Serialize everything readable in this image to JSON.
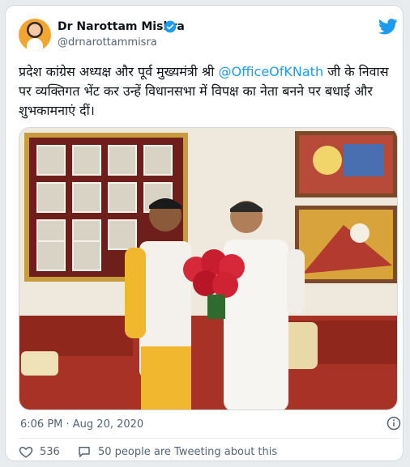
{
  "user": {
    "name": "Dr Narottam Mishra",
    "handle": "@drnarottammisra"
  },
  "tweet": {
    "text_before": "प्रदेश कांग्रेस अध्यक्ष और पूर्व मुख्यमंत्री श्री ",
    "mention": "@OfficeOfKNath",
    "text_after": " जी के निवास पर व्यक्तिगत भेंट कर उन्हें विधानसभा में विपक्ष का नेता बनने पर बधाई और शुभकामनाएं दीं।"
  },
  "meta": {
    "timestamp": "6:06 PM · Aug 20, 2020"
  },
  "actions": {
    "likes": "536",
    "tweeting": "50 people are Tweeting about this"
  },
  "icons": {
    "verified": "verified-badge-icon",
    "bird": "twitter-bird-icon",
    "info": "info-icon",
    "like": "heart-icon",
    "tweeting": "speech-bubble-icon"
  },
  "colors": {
    "accent": "#1d9bf0",
    "text": "#0f1419",
    "muted": "#536471",
    "like": "#e0245e"
  }
}
